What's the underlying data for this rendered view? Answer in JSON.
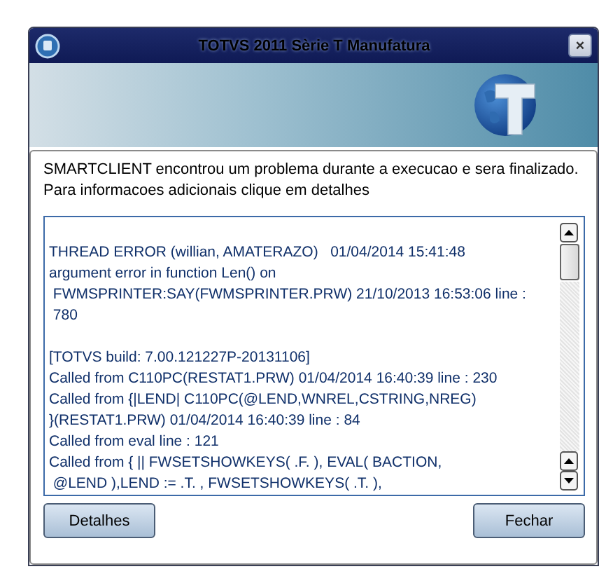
{
  "window": {
    "title": "TOTVS 2011 Sèrie T Manufatura",
    "close": "×"
  },
  "message": [
    "SMARTCLIENT encontrou um problema durante a execucao e sera finalizado.",
    "Para informacoes adicionais clique em detalhes"
  ],
  "log": [
    [
      "THREAD ERROR (willian, AMATERAZO)   01/04/2014 15:41:48",
      "argument error in function Len() on",
      " FWMSPRINTER:SAY(FWMSPRINTER.PRW) 21/10/2013 16:53:06 line :",
      " 780"
    ],
    [
      "[TOTVS build: 7.00.121227P-20131106]",
      "Called from C110PC(RESTAT1.PRW) 01/04/2014 16:40:39 line : 230",
      "Called from {|LEND| C110PC(@LEND,WNREL,CSTRING,NREG)",
      "}(RESTAT1.PRW) 01/04/2014 16:40:39 line : 84",
      "Called from eval line : 121",
      "Called from { || FWSETSHOWKEYS( .F. ), EVAL( BACTION,",
      " @LEND ),LEND := .T. , FWSETSHOWKEYS( .T. ),"
    ]
  ],
  "buttons": [
    "Detalhes",
    "Fechar"
  ]
}
